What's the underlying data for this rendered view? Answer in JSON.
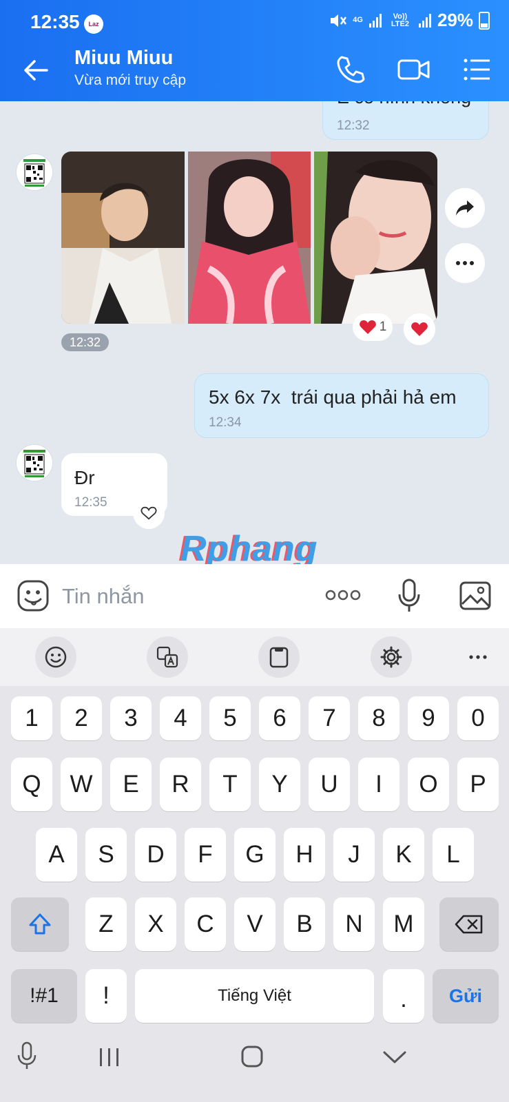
{
  "status_bar": {
    "time": "12:35",
    "app_badge": "Laz",
    "network": "4G",
    "volte": "Vo)) LTE2",
    "battery": "29%"
  },
  "header": {
    "name": "Miuu Miuu",
    "subtitle": "Vừa mới truy cập"
  },
  "messages": {
    "prev_out": {
      "text": "E có hình không",
      "time": "12:32"
    },
    "photos_time": "12:32",
    "reaction_count": "1",
    "out_msg": {
      "text": "5x 6x 7x  trái qua phải hả em",
      "time": "12:34"
    },
    "in_msg": {
      "text": "Đr",
      "time": "12:35"
    }
  },
  "watermark": "Rphang",
  "input": {
    "placeholder": "Tin nhắn"
  },
  "keyboard": {
    "row_numbers": [
      "1",
      "2",
      "3",
      "4",
      "5",
      "6",
      "7",
      "8",
      "9",
      "0"
    ],
    "row_q": [
      "Q",
      "W",
      "E",
      "R",
      "T",
      "Y",
      "U",
      "I",
      "O",
      "P"
    ],
    "row_a": [
      "A",
      "S",
      "D",
      "F",
      "G",
      "H",
      "J",
      "K",
      "L"
    ],
    "row_z": [
      "Z",
      "X",
      "C",
      "V",
      "B",
      "N",
      "M"
    ],
    "symbols": "!#1",
    "exclaim": "!",
    "space": "Tiếng Việt",
    "period": ".",
    "send": "Gửi"
  },
  "colors": {
    "header_start": "#1a6ff0",
    "header_end": "#2b90ff",
    "out_bubble": "#d6ecfb",
    "send_key": "#1a73e8"
  }
}
